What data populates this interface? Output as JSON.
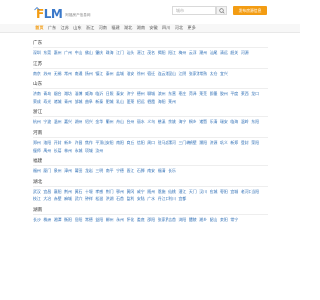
{
  "header": {
    "logo_f": "F",
    "logo_rest": "LM",
    "tagline": "阿福房产信息网",
    "search_placeholder": "城市",
    "cta_label": "发布房源信息"
  },
  "nav": {
    "items": [
      "首页",
      "广东",
      "江苏",
      "山东",
      "浙江",
      "河南",
      "福建",
      "湖北",
      "湖南",
      "安徽",
      "四川",
      "河北",
      "更多"
    ],
    "active_index": 0
  },
  "sections": [
    {
      "title": "广东",
      "cities": [
        "深圳",
        "东莞",
        "惠州",
        "广州",
        "中山",
        "佛山",
        "肇庆",
        "珠海",
        "江门",
        "汕头",
        "湛江",
        "茂名",
        "揭阳",
        "阳江",
        "梅州",
        "云浮",
        "潮州",
        "汕尾",
        "清远",
        "韶关",
        "河源"
      ]
    },
    {
      "title": "江苏",
      "cities": [
        "南京",
        "苏州",
        "无锡",
        "常州",
        "南通",
        "扬州",
        "镇江",
        "泰州",
        "盐城",
        "淮安",
        "徐州",
        "宿迁",
        "连云港",
        "昆山",
        "江阴",
        "张家港",
        "常熟",
        "太仓",
        "宜兴"
      ]
    },
    {
      "title": "山东",
      "cities": [
        "济南",
        "青岛",
        "烟台",
        "潍坊",
        "淄博",
        "威海",
        "临沂",
        "日照",
        "泰安",
        "济宁",
        "德州",
        "聊城",
        "滨州",
        "东营",
        "枣庄",
        "菏泽",
        "莱芜",
        "即墨",
        "胶州",
        "平度",
        "莱西",
        "龙口",
        "荣成",
        "寿光",
        "诸城",
        "青州",
        "邹城",
        "曲阜",
        "新泰",
        "肥城",
        "乳山",
        "蓬莱",
        "招远",
        "栖霞",
        "海阳",
        "莱州"
      ]
    },
    {
      "title": "浙江",
      "cities": [
        "杭州",
        "宁波",
        "温州",
        "嘉兴",
        "湖州",
        "绍兴",
        "金华",
        "衢州",
        "舟山",
        "台州",
        "丽水",
        "义乌",
        "慈溪",
        "余姚",
        "海宁",
        "桐乡",
        "诸暨",
        "乐清",
        "瑞安",
        "临海",
        "温岭",
        "东阳"
      ]
    },
    {
      "title": "河南",
      "cities": [
        "郑州",
        "洛阳",
        "开封",
        "新乡",
        "许昌",
        "焦作",
        "平顶山",
        "安阳",
        "南阳",
        "商丘",
        "信阳",
        "周口",
        "驻马店",
        "漯河",
        "三门峡",
        "鹤壁",
        "濮阳",
        "济源",
        "巩义",
        "新郑",
        "登封",
        "荥阳",
        "偃师",
        "禹州",
        "长葛",
        "林州",
        "永城",
        "项城",
        "汝州"
      ]
    },
    {
      "title": "福建",
      "cities": [
        "福州",
        "厦门",
        "泉州",
        "漳州",
        "莆田",
        "龙岩",
        "三明",
        "南平",
        "宁德",
        "晋江",
        "石狮",
        "南安",
        "福清",
        "长乐"
      ]
    },
    {
      "title": "湖北",
      "cities": [
        "武汉",
        "宜昌",
        "襄阳",
        "荆州",
        "黄石",
        "十堰",
        "孝感",
        "荆门",
        "鄂州",
        "黄冈",
        "咸宁",
        "随州",
        "恩施",
        "仙桃",
        "潜江",
        "天门",
        "汉川",
        "应城",
        "枣阳",
        "宜城",
        "老河口",
        "当阳",
        "枝江",
        "大冶",
        "赤壁",
        "麻城",
        "武穴",
        "钟祥",
        "松滋",
        "洪湖",
        "石首",
        "监利",
        "安陆",
        "广水",
        "丹江口",
        "利川",
        "宜都"
      ]
    },
    {
      "title": "湖南",
      "cities": [
        "长沙",
        "株洲",
        "湘潭",
        "衡阳",
        "岳阳",
        "常德",
        "益阳",
        "郴州",
        "永州",
        "怀化",
        "娄底",
        "邵阳",
        "张家界",
        "吉首",
        "浏阳",
        "醴陵",
        "湘乡",
        "韶山",
        "耒阳",
        "常宁"
      ]
    }
  ]
}
